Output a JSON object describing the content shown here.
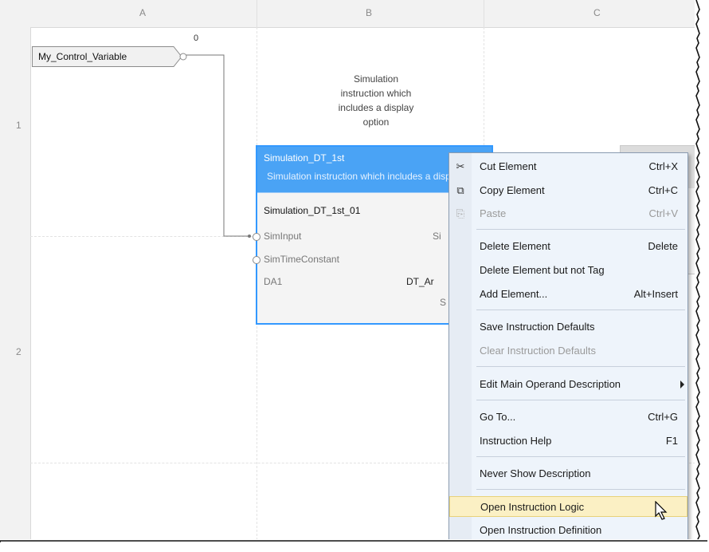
{
  "columns": [
    "A",
    "B",
    "C"
  ],
  "rows": [
    "1",
    "2"
  ],
  "input_tag": {
    "name": "My_Control_Variable",
    "value": "0"
  },
  "comment_lines": [
    "Simulation",
    "instruction which",
    "includes a display",
    "option"
  ],
  "block": {
    "title": "Simulation_DT_1st",
    "description": "Simulation instruction which includes a display option",
    "tag_name": "Simulation_DT_1st_01",
    "pins": [
      {
        "left": "SimInput",
        "right": "Si"
      },
      {
        "left": "SimTimeConstant",
        "right": ""
      },
      {
        "left": "DA1",
        "right": "DT_Ar"
      },
      {
        "left": "",
        "right": "S"
      }
    ]
  },
  "context_menu": {
    "items": [
      {
        "label": "Cut Element",
        "shortcut": "Ctrl+X",
        "icon": "scissors-icon",
        "glyph": "✂",
        "enabled": true
      },
      {
        "label": "Copy Element",
        "shortcut": "Ctrl+C",
        "icon": "copy-icon",
        "glyph": "⧉",
        "enabled": true
      },
      {
        "label": "Paste",
        "shortcut": "Ctrl+V",
        "icon": "paste-icon",
        "glyph": "⎘",
        "enabled": false
      },
      {
        "label": "Delete Element",
        "shortcut": "Delete",
        "enabled": true
      },
      {
        "label": "Delete Element but not Tag",
        "shortcut": "",
        "enabled": true
      },
      {
        "label": "Add Element...",
        "shortcut": "Alt+Insert",
        "enabled": true
      },
      {
        "label": "Save Instruction Defaults",
        "shortcut": "",
        "enabled": true
      },
      {
        "label": "Clear Instruction Defaults",
        "shortcut": "",
        "enabled": false
      },
      {
        "label": "Edit Main Operand Description",
        "shortcut": "",
        "enabled": true,
        "submenu": true
      },
      {
        "label": "Go To...",
        "shortcut": "Ctrl+G",
        "enabled": true
      },
      {
        "label": "Instruction Help",
        "shortcut": "F1",
        "enabled": true
      },
      {
        "label": "Never Show Description",
        "shortcut": "",
        "enabled": true
      },
      {
        "label": "Open Instruction Logic",
        "shortcut": "",
        "enabled": true,
        "highlighted": true
      },
      {
        "label": "Open Instruction Definition",
        "shortcut": "",
        "enabled": true
      }
    ]
  },
  "colors": {
    "block_border": "#3399ff",
    "block_header": "#4aa3f5",
    "menu_background": "#eef4fb",
    "menu_highlight": "#fbf0c4"
  }
}
